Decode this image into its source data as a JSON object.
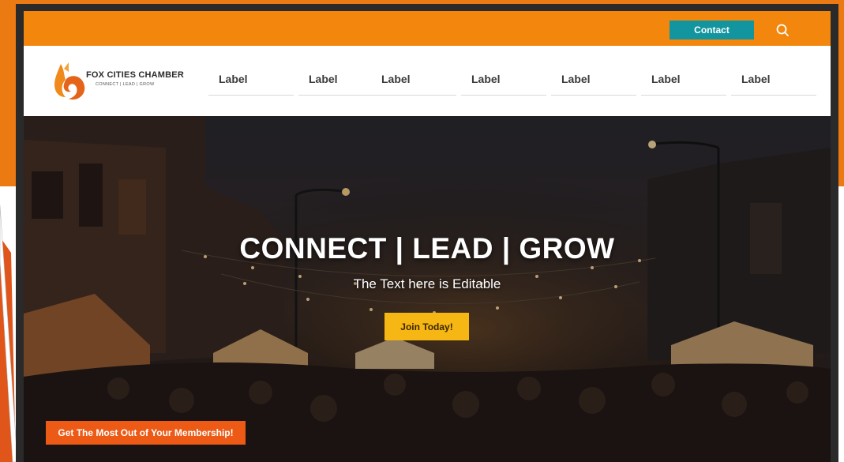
{
  "colors": {
    "slide_orange": "#ec7a12",
    "topbar": "#f3860c",
    "contact": "#12959e",
    "join": "#f6b613",
    "membership": "#ec5a16"
  },
  "topbar": {
    "contact_label": "Contact",
    "search_icon": "search-icon"
  },
  "logo": {
    "name": "FOX CITIES CHAMBER",
    "tagline": "CONNECT | LEAD | GROW"
  },
  "nav": {
    "items": [
      {
        "label": "Label"
      },
      {
        "label": "Label"
      },
      {
        "label": "Label"
      },
      {
        "label": "Label"
      },
      {
        "label": "Label"
      },
      {
        "label": "Label"
      },
      {
        "label": "Label"
      }
    ]
  },
  "hero": {
    "title": "CONNECT | LEAD | GROW",
    "subtitle": "The Text here is Editable",
    "join_label": "Join Today!",
    "membership_label": "Get The Most Out of Your Membership!"
  }
}
